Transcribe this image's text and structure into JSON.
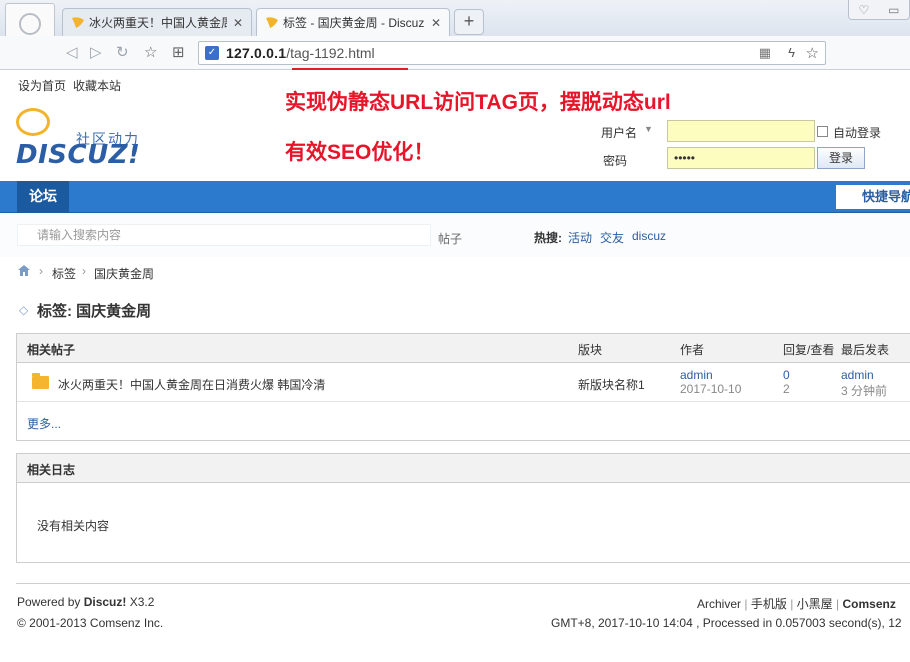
{
  "browser": {
    "tabs": [
      {
        "title": "冰火两重天！中国人黄金周"
      },
      {
        "title": "标签 - 国庆黄金周 - Discuz"
      }
    ],
    "new_tab": "+",
    "url_host": "127.0.0.1",
    "url_path": "/tag-1192.html"
  },
  "topbar": {
    "set_home": "设为首页",
    "bookmark": "收藏本站"
  },
  "logo": {
    "brand": "DISCUZ!",
    "tagline": "社区动力"
  },
  "promo": {
    "line1": "实现伪静态URL访问TAG页，摆脱动态url",
    "line2": "有效SEO优化！"
  },
  "login": {
    "username_label": "用户名",
    "password_label": "密码",
    "password_mask": "•••••",
    "remember": "自动登录",
    "login_button": "登录"
  },
  "nav": {
    "forum": "论坛",
    "quick_nav": "快捷导航"
  },
  "search": {
    "placeholder": "请输入搜索内容",
    "type": "帖子",
    "hot_label": "热搜:",
    "hot_terms": [
      "活动",
      "交友",
      "discuz"
    ]
  },
  "breadcrumb": {
    "items": [
      "标签",
      "国庆黄金周"
    ]
  },
  "tag": {
    "title": "标签: 国庆黄金周"
  },
  "threads": {
    "heading": "相关帖子",
    "columns": [
      "版块",
      "作者",
      "回复/查看",
      "最后发表"
    ],
    "rows": [
      {
        "title": "冰火两重天！中国人黄金周在日消费火爆 韩国冷清",
        "forum": "新版块名称1",
        "author": "admin",
        "date": "2017-10-10",
        "replies": "0",
        "views": "2",
        "last_user": "admin",
        "last_time": "3 分钟前"
      }
    ],
    "more": "更多..."
  },
  "blogs": {
    "heading": "相关日志",
    "empty": "没有相关内容"
  },
  "footer": {
    "powered_prefix": "Powered by ",
    "powered_brand": "Discuz!",
    "version": " X3.2",
    "copyright": "© 2001-2013 Comsenz Inc.",
    "links": [
      "Archiver",
      "手机版",
      "小黑屋",
      "Comsenz"
    ],
    "stats": "GMT+8, 2017-10-10 14:04 , Processed in 0.057003 second(s), 12"
  },
  "colors": {
    "nav_blue": "#2b7acd",
    "promo_red": "#e8142a",
    "link_blue": "#2b5ea0"
  }
}
